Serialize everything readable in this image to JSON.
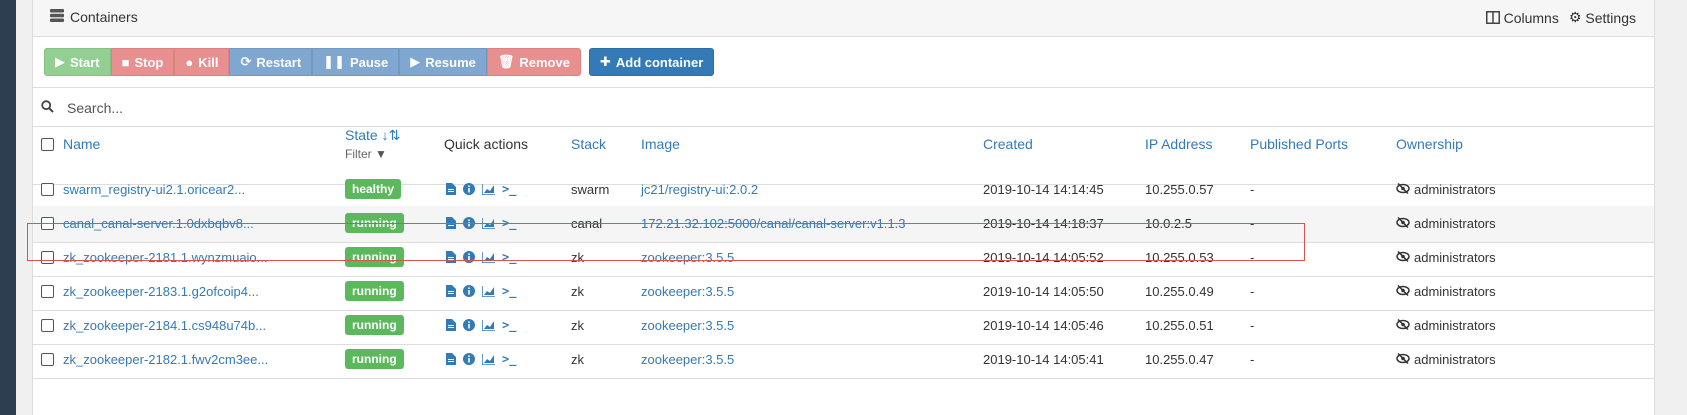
{
  "header": {
    "title": "Containers",
    "columns_label": "Columns",
    "settings_label": "Settings"
  },
  "actions": {
    "start": "Start",
    "stop": "Stop",
    "kill": "Kill",
    "restart": "Restart",
    "pause": "Pause",
    "resume": "Resume",
    "remove": "Remove",
    "add": "Add container"
  },
  "search": {
    "placeholder": "Search..."
  },
  "columns": {
    "name": "Name",
    "state": "State",
    "state_filter": "Filter",
    "quick_actions": "Quick actions",
    "stack": "Stack",
    "image": "Image",
    "created": "Created",
    "ip": "IP Address",
    "ports": "Published Ports",
    "ownership": "Ownership"
  },
  "rows": [
    {
      "name": "swarm_registry-ui2.1.oricear2...",
      "state": "healthy",
      "stack": "swarm",
      "image": "jc21/registry-ui:2.0.2",
      "created": "2019-10-14 14:14:45",
      "ip": "10.255.0.57",
      "ports": "-",
      "ownership": "administrators"
    },
    {
      "name": "canal_canal-server.1.0dxbqbv8...",
      "state": "running",
      "stack": "canal",
      "image": "172.21.32.102:5000/canal/canal-server:v1.1.3",
      "created": "2019-10-14 14:18:37",
      "ip": "10.0.2.5",
      "ports": "-",
      "ownership": "administrators"
    },
    {
      "name": "zk_zookeeper-2181.1.wynzmuaio...",
      "state": "running",
      "stack": "zk",
      "image": "zookeeper:3.5.5",
      "created": "2019-10-14 14:05:52",
      "ip": "10.255.0.53",
      "ports": "-",
      "ownership": "administrators"
    },
    {
      "name": "zk_zookeeper-2183.1.g2ofcoip4...",
      "state": "running",
      "stack": "zk",
      "image": "zookeeper:3.5.5",
      "created": "2019-10-14 14:05:50",
      "ip": "10.255.0.49",
      "ports": "-",
      "ownership": "administrators"
    },
    {
      "name": "zk_zookeeper-2184.1.cs948u74b...",
      "state": "running",
      "stack": "zk",
      "image": "zookeeper:3.5.5",
      "created": "2019-10-14 14:05:46",
      "ip": "10.255.0.51",
      "ports": "-",
      "ownership": "administrators"
    },
    {
      "name": "zk_zookeeper-2182.1.fwv2cm3ee...",
      "state": "running",
      "stack": "zk",
      "image": "zookeeper:3.5.5",
      "created": "2019-10-14 14:05:41",
      "ip": "10.255.0.47",
      "ports": "-",
      "ownership": "administrators"
    }
  ],
  "colors": {
    "link": "#337ab7",
    "success": "#5cb85c",
    "danger": "#d9534f"
  }
}
